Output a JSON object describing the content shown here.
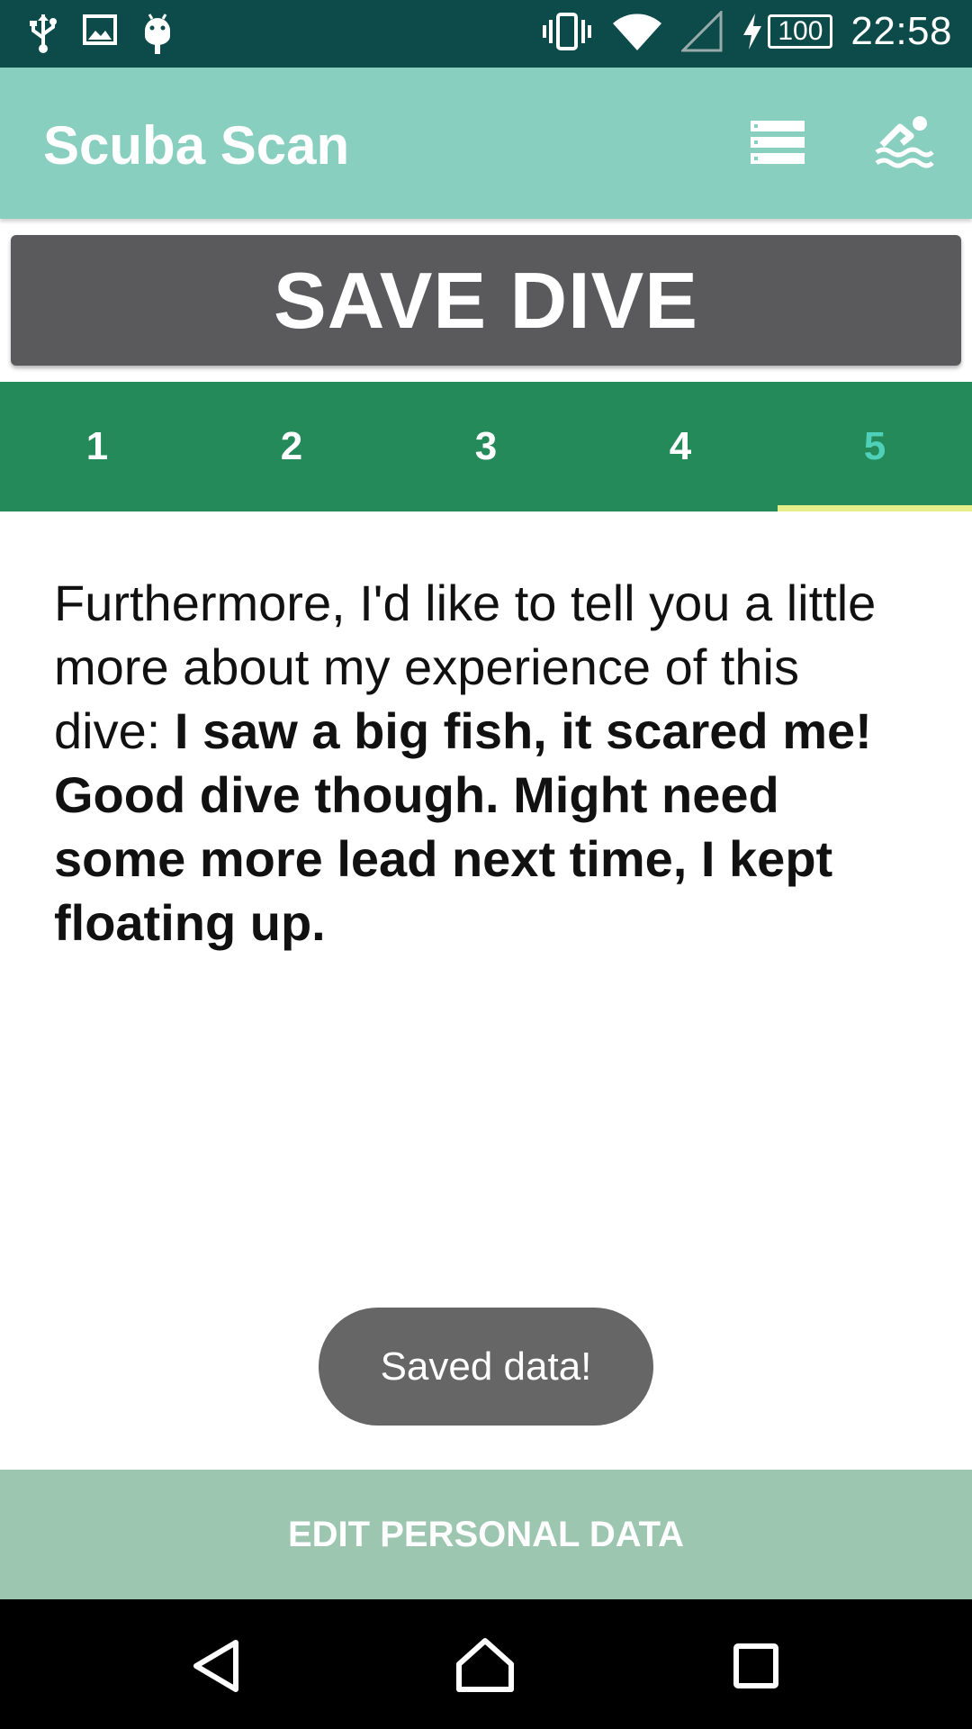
{
  "status_bar": {
    "left_icons": [
      "usb-icon",
      "image-icon",
      "android-debug-icon"
    ],
    "right_icons": [
      "vibrate-icon",
      "wifi-icon",
      "cell-signal-icon",
      "charging-icon"
    ],
    "battery_level": "100",
    "time": "22:58"
  },
  "app_bar": {
    "title": "Scuba Scan",
    "actions": [
      "list-icon",
      "swimmer-icon"
    ]
  },
  "save_button": {
    "label": "SAVE DIVE"
  },
  "tabs": {
    "items": [
      {
        "label": "1"
      },
      {
        "label": "2"
      },
      {
        "label": "3"
      },
      {
        "label": "4"
      },
      {
        "label": "5"
      }
    ],
    "active_index": 4
  },
  "content": {
    "intro": "Furthermore, I'd like to tell you a little more about my experience of this dive: ",
    "answer": "I saw a big fish, it scared me! Good dive though. Might need some more lead next time, I kept floating up."
  },
  "toast": {
    "message": "Saved data!"
  },
  "edit_button": {
    "label": "EDIT PERSONAL DATA"
  },
  "nav_bar": {
    "icons": [
      "back-icon",
      "home-icon",
      "recents-icon"
    ]
  },
  "colors": {
    "status_bar": "#0d4a4a",
    "app_bar": "#88cfc0",
    "save_button": "#5a5a5c",
    "tabs_bg": "#248a5a",
    "tab_active_text": "#4fd0b8",
    "tab_indicator": "#e6ee8a",
    "edit_button": "#9cc6b0"
  }
}
